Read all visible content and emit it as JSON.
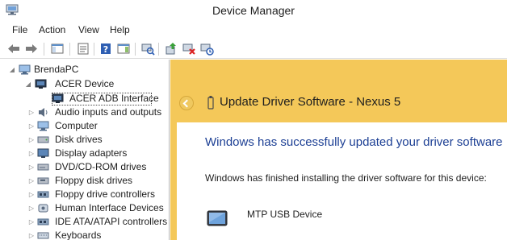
{
  "window": {
    "title": "Device Manager",
    "icon": "device-manager-icon"
  },
  "menu": {
    "items": [
      "File",
      "Action",
      "View",
      "Help"
    ]
  },
  "toolbar": {
    "buttons": [
      {
        "name": "back-arrow-icon"
      },
      {
        "name": "forward-arrow-icon"
      },
      {
        "name": "show-hide-console-tree-icon"
      },
      {
        "name": "properties-icon"
      },
      {
        "name": "help-icon"
      },
      {
        "name": "action-pane-icon"
      },
      {
        "name": "scan-hardware-changes-icon"
      },
      {
        "name": "update-driver-icon"
      },
      {
        "name": "uninstall-device-icon"
      },
      {
        "name": "enable-device-icon"
      }
    ]
  },
  "tree": {
    "root": "BrendaPC",
    "nodes": [
      {
        "label": "ACER Device",
        "expanded": true
      },
      {
        "label": "ACER ADB Interface",
        "selected": true
      },
      {
        "label": "Audio inputs and outputs"
      },
      {
        "label": "Computer"
      },
      {
        "label": "Disk drives"
      },
      {
        "label": "Display adapters"
      },
      {
        "label": "DVD/CD-ROM drives"
      },
      {
        "label": "Floppy disk drives"
      },
      {
        "label": "Floppy drive controllers"
      },
      {
        "label": "Human Interface Devices"
      },
      {
        "label": "IDE ATA/ATAPI controllers"
      },
      {
        "label": "Keyboards"
      }
    ]
  },
  "wizard": {
    "title": "Update Driver Software - Nexus 5",
    "heading": "Windows has successfully updated your driver software",
    "body": "Windows has finished installing the driver software for this device:",
    "device_name": "MTP USB Device"
  },
  "colors": {
    "wizard_frame": "#f4c859",
    "heading_blue": "#1c3f94"
  }
}
